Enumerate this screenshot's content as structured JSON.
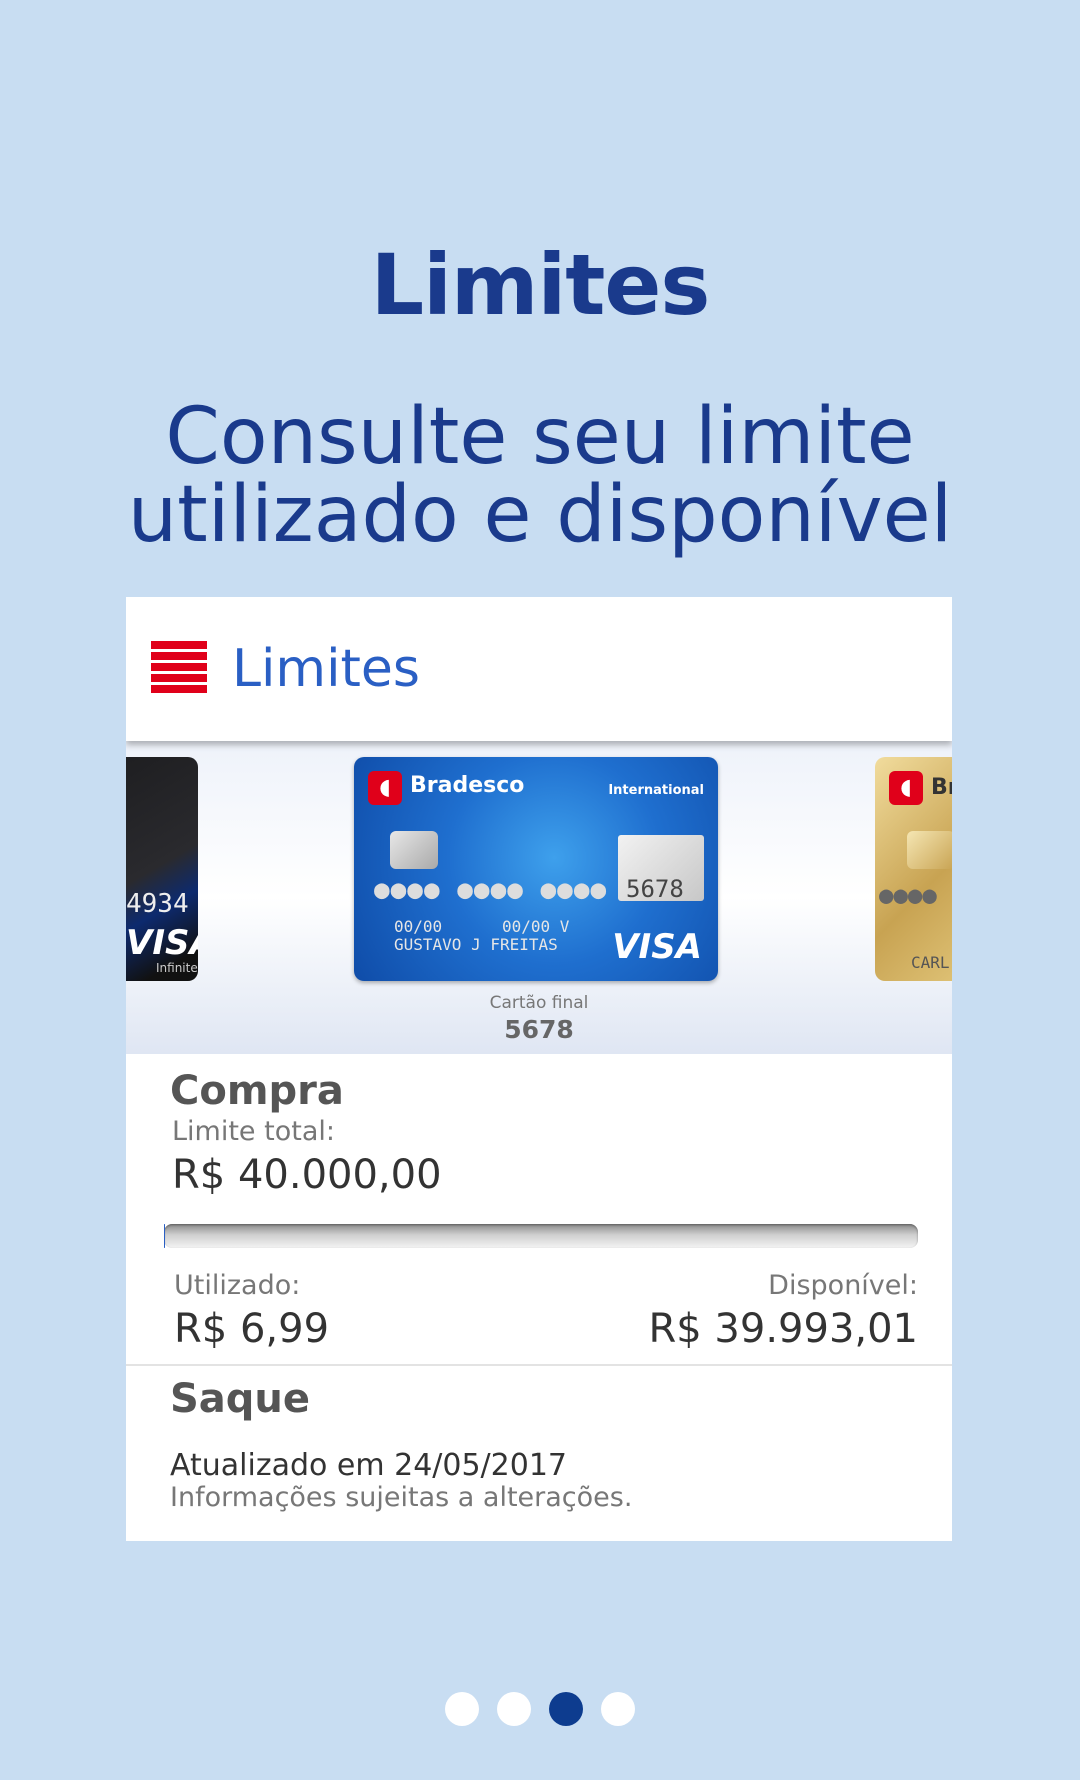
{
  "promo": {
    "title": "Limites",
    "subtitle_line1": "Consulte seu limite",
    "subtitle_line2": "utilizado e disponível"
  },
  "app": {
    "appbar_title": "Limites",
    "cards": {
      "left_card": {
        "number_suffix": "4934",
        "brand": "VISA",
        "tier": "Infinite"
      },
      "center_card": {
        "bank": "Bradesco",
        "label": "International",
        "number": "●●●● ●●●● ●●●●",
        "last_digits": "5678",
        "valid_from": "00/00",
        "valid_to": "00/00 V",
        "holder": "GUSTAVO J FREITAS",
        "brand": "VISA"
      },
      "right_card": {
        "bank_partial": "Br",
        "dots": "●●●●",
        "holder_partial": "CARL"
      }
    },
    "card_final_label": "Cartão final",
    "card_final_number": "5678",
    "compra": {
      "title": "Compra",
      "limit_label": "Limite total:",
      "limit_value": "R$ 40.000,00",
      "used_fraction": 0.00017,
      "used_label": "Utilizado:",
      "used_value": "R$ 6,99",
      "available_label": "Disponível:",
      "available_value": "R$ 39.993,01"
    },
    "saque": {
      "title": "Saque",
      "updated": "Atualizado em 24/05/2017",
      "info": "Informações sujeitas a alterações."
    }
  },
  "pagination": {
    "count": 4,
    "active_index": 2
  },
  "colors": {
    "background": "#c8ddf2",
    "accent": "#1a3a8c",
    "link": "#2a5fc4",
    "menu_red": "#e0001a"
  }
}
